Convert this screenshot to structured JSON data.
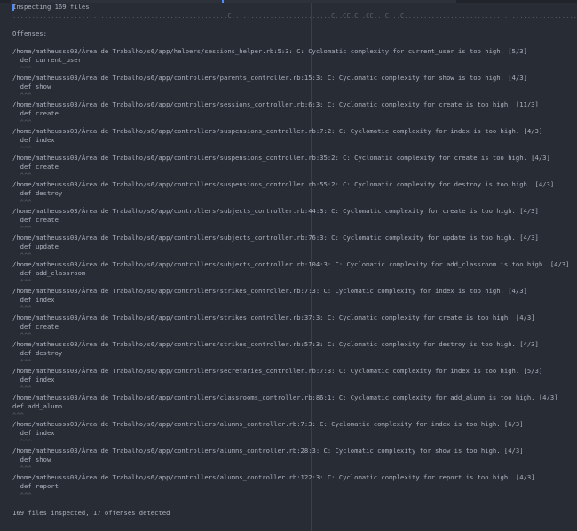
{
  "header": {
    "inspecting": "Inspecting 169 files"
  },
  "progress": "........................................................C..........................C..CC.C..CC...C...C....................................................................................",
  "offenses_label": "Offenses:",
  "offenses": [
    {
      "message": "/home/matheusss03/Área de Trabalho/s6/app/helpers/sessions_helper.rb:5:3: C: Cyclomatic complexity for current_user is too high. [5/3]",
      "code": "  def current_user",
      "caret": "  ^^^"
    },
    {
      "message": "/home/matheusss03/Área de Trabalho/s6/app/controllers/parents_controller.rb:15:3: C: Cyclomatic complexity for show is too high. [4/3]",
      "code": "  def show",
      "caret": "  ^^^"
    },
    {
      "message": "/home/matheusss03/Área de Trabalho/s6/app/controllers/sessions_controller.rb:6:3: C: Cyclomatic complexity for create is too high. [11/3]",
      "code": "  def create",
      "caret": "  ^^^"
    },
    {
      "message": "/home/matheusss03/Área de Trabalho/s6/app/controllers/suspensions_controller.rb:7:2: C: Cyclomatic complexity for index is too high. [4/3]",
      "code": "  def index",
      "caret": "  ^^^"
    },
    {
      "message": "/home/matheusss03/Área de Trabalho/s6/app/controllers/suspensions_controller.rb:35:2: C: Cyclomatic complexity for create is too high. [4/3]",
      "code": "  def create",
      "caret": "  ^^^"
    },
    {
      "message": "/home/matheusss03/Área de Trabalho/s6/app/controllers/suspensions_controller.rb:55:2: C: Cyclomatic complexity for destroy is too high. [4/3]",
      "code": "  def destroy",
      "caret": "  ^^^"
    },
    {
      "message": "/home/matheusss03/Área de Trabalho/s6/app/controllers/subjects_controller.rb:44:3: C: Cyclomatic complexity for create is too high. [4/3]",
      "code": "  def create",
      "caret": "  ^^^"
    },
    {
      "message": "/home/matheusss03/Área de Trabalho/s6/app/controllers/subjects_controller.rb:76:3: C: Cyclomatic complexity for update is too high. [4/3]",
      "code": "  def update",
      "caret": "  ^^^"
    },
    {
      "message": "/home/matheusss03/Área de Trabalho/s6/app/controllers/subjects_controller.rb:104:3: C: Cyclomatic complexity for add_classroom is too high. [4/3]",
      "code": "  def add_classroom",
      "caret": "  ^^^"
    },
    {
      "message": "/home/matheusss03/Área de Trabalho/s6/app/controllers/strikes_controller.rb:7:3: C: Cyclomatic complexity for index is too high. [4/3]",
      "code": "  def index",
      "caret": "  ^^^"
    },
    {
      "message": "/home/matheusss03/Área de Trabalho/s6/app/controllers/strikes_controller.rb:37:3: C: Cyclomatic complexity for create is too high. [4/3]",
      "code": "  def create",
      "caret": "  ^^^"
    },
    {
      "message": "/home/matheusss03/Área de Trabalho/s6/app/controllers/strikes_controller.rb:57:3: C: Cyclomatic complexity for destroy is too high. [4/3]",
      "code": "  def destroy",
      "caret": "  ^^^"
    },
    {
      "message": "/home/matheusss03/Área de Trabalho/s6/app/controllers/secretaries_controller.rb:7:3: C: Cyclomatic complexity for index is too high. [5/3]",
      "code": "  def index",
      "caret": "  ^^^"
    },
    {
      "message": "/home/matheusss03/Área de Trabalho/s6/app/controllers/classrooms_controller.rb:86:1: C: Cyclomatic complexity for add_alumn is too high. [4/3]",
      "code": "def add_alumn",
      "caret": "^^^"
    },
    {
      "message": "/home/matheusss03/Área de Trabalho/s6/app/controllers/alumns_controller.rb:7:3: C: Cyclomatic complexity for index is too high. [6/3]",
      "code": "  def index",
      "caret": "  ^^^"
    },
    {
      "message": "/home/matheusss03/Área de Trabalho/s6/app/controllers/alumns_controller.rb:28:3: C: Cyclomatic complexity for show is too high. [4/3]",
      "code": "  def show",
      "caret": "  ^^^"
    },
    {
      "message": "/home/matheusss03/Área de Trabalho/s6/app/controllers/alumns_controller.rb:122:3: C: Cyclomatic complexity for report is too high. [4/3]",
      "code": "  def report",
      "caret": "  ^^^"
    }
  ],
  "summary": "169 files inspected, 17 offenses detected"
}
